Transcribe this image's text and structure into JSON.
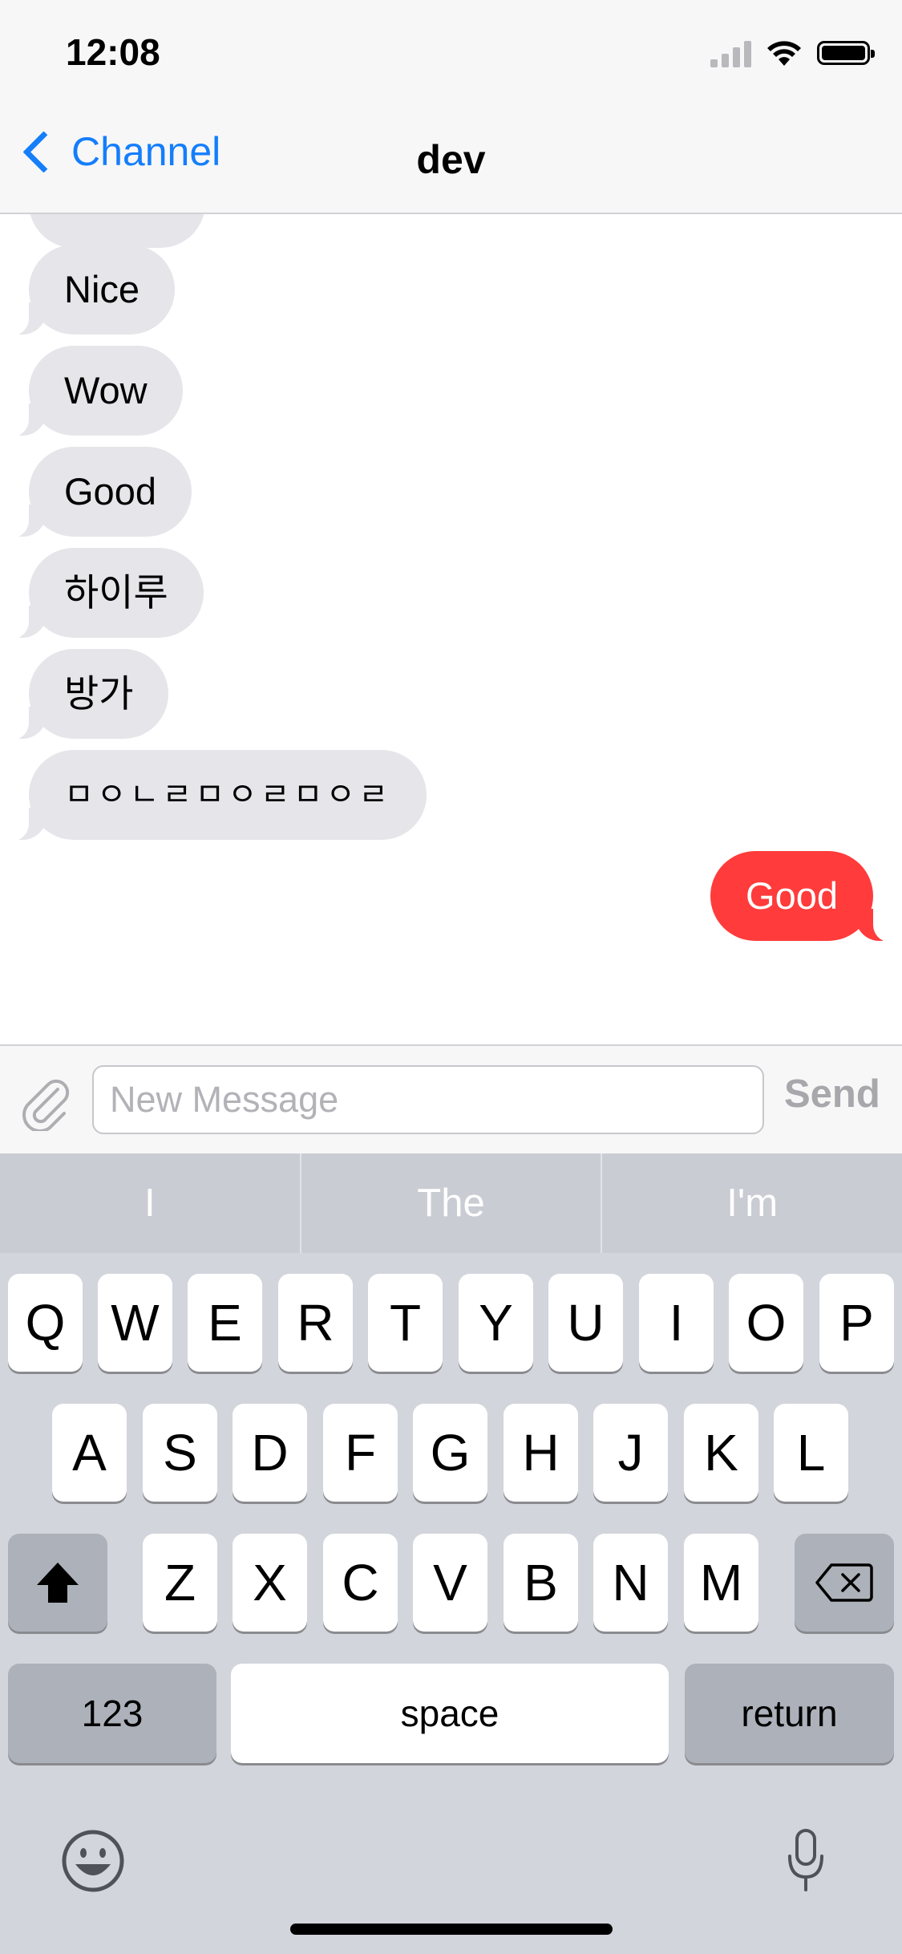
{
  "status": {
    "time": "12:08"
  },
  "nav": {
    "back_label": "Channel",
    "title": "dev"
  },
  "messages": [
    {
      "text": "Nice",
      "direction": "incoming"
    },
    {
      "text": "Wow",
      "direction": "incoming"
    },
    {
      "text": "Good",
      "direction": "incoming"
    },
    {
      "text": "하이루",
      "direction": "incoming"
    },
    {
      "text": "방가",
      "direction": "incoming"
    },
    {
      "text": "ㅁㅇㄴㄹㅁㅇㄹㅁㅇㄹ",
      "direction": "incoming"
    },
    {
      "text": "Good",
      "direction": "outgoing"
    }
  ],
  "composer": {
    "placeholder": "New Message",
    "send_label": "Send"
  },
  "keyboard": {
    "suggestions": [
      "I",
      "The",
      "I'm"
    ],
    "row1": [
      "Q",
      "W",
      "E",
      "R",
      "T",
      "Y",
      "U",
      "I",
      "O",
      "P"
    ],
    "row2": [
      "A",
      "S",
      "D",
      "F",
      "G",
      "H",
      "J",
      "K",
      "L"
    ],
    "row3": [
      "Z",
      "X",
      "C",
      "V",
      "B",
      "N",
      "M"
    ],
    "numbers_label": "123",
    "space_label": "space",
    "return_label": "return"
  },
  "colors": {
    "accent": "#147efb",
    "outgoing_bubble": "#ff3b3b",
    "incoming_bubble": "#e5e5ea"
  }
}
